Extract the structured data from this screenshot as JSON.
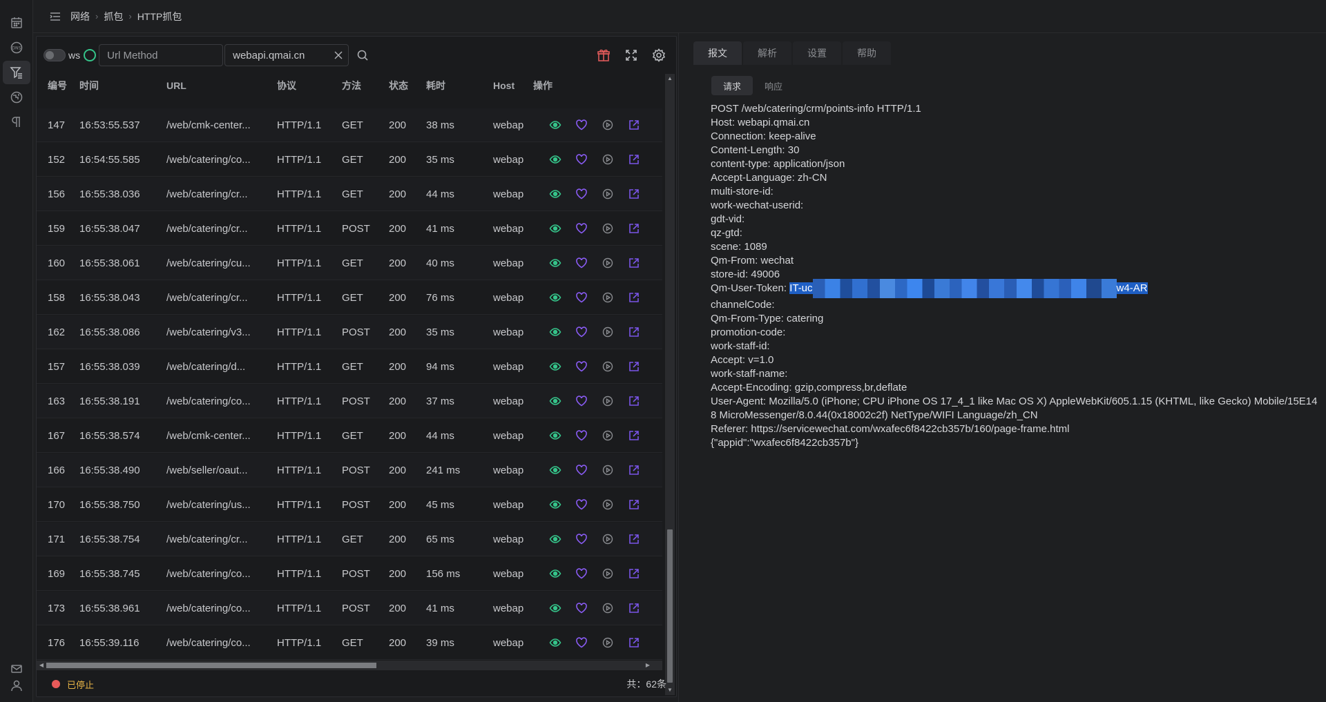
{
  "breadcrumb": [
    "网络",
    "抓包",
    "HTTP抓包"
  ],
  "toolbar": {
    "ws_label": "ws",
    "url_placeholder": "Url Method",
    "host_value": "webapi.qmai.cn"
  },
  "table": {
    "headers": [
      "编号",
      "时间",
      "URL",
      "协议",
      "方法",
      "状态",
      "耗时",
      "Host",
      "操作"
    ],
    "rows": [
      {
        "id": "147",
        "time": "16:53:55.537",
        "url": "/web/cmk-center...",
        "proto": "HTTP/1.1",
        "method": "GET",
        "status": "200",
        "cost": "38 ms",
        "host": "webap"
      },
      {
        "id": "152",
        "time": "16:54:55.585",
        "url": "/web/catering/co...",
        "proto": "HTTP/1.1",
        "method": "GET",
        "status": "200",
        "cost": "35 ms",
        "host": "webap"
      },
      {
        "id": "156",
        "time": "16:55:38.036",
        "url": "/web/catering/cr...",
        "proto": "HTTP/1.1",
        "method": "GET",
        "status": "200",
        "cost": "44 ms",
        "host": "webap"
      },
      {
        "id": "159",
        "time": "16:55:38.047",
        "url": "/web/catering/cr...",
        "proto": "HTTP/1.1",
        "method": "POST",
        "status": "200",
        "cost": "41 ms",
        "host": "webap"
      },
      {
        "id": "160",
        "time": "16:55:38.061",
        "url": "/web/catering/cu...",
        "proto": "HTTP/1.1",
        "method": "GET",
        "status": "200",
        "cost": "40 ms",
        "host": "webap"
      },
      {
        "id": "158",
        "time": "16:55:38.043",
        "url": "/web/catering/cr...",
        "proto": "HTTP/1.1",
        "method": "GET",
        "status": "200",
        "cost": "76 ms",
        "host": "webap"
      },
      {
        "id": "162",
        "time": "16:55:38.086",
        "url": "/web/catering/v3...",
        "proto": "HTTP/1.1",
        "method": "POST",
        "status": "200",
        "cost": "35 ms",
        "host": "webap"
      },
      {
        "id": "157",
        "time": "16:55:38.039",
        "url": "/web/catering/d...",
        "proto": "HTTP/1.1",
        "method": "GET",
        "status": "200",
        "cost": "94 ms",
        "host": "webap"
      },
      {
        "id": "163",
        "time": "16:55:38.191",
        "url": "/web/catering/co...",
        "proto": "HTTP/1.1",
        "method": "POST",
        "status": "200",
        "cost": "37 ms",
        "host": "webap"
      },
      {
        "id": "167",
        "time": "16:55:38.574",
        "url": "/web/cmk-center...",
        "proto": "HTTP/1.1",
        "method": "GET",
        "status": "200",
        "cost": "44 ms",
        "host": "webap"
      },
      {
        "id": "166",
        "time": "16:55:38.490",
        "url": "/web/seller/oaut...",
        "proto": "HTTP/1.1",
        "method": "POST",
        "status": "200",
        "cost": "241 ms",
        "host": "webap"
      },
      {
        "id": "170",
        "time": "16:55:38.750",
        "url": "/web/catering/us...",
        "proto": "HTTP/1.1",
        "method": "POST",
        "status": "200",
        "cost": "45 ms",
        "host": "webap"
      },
      {
        "id": "171",
        "time": "16:55:38.754",
        "url": "/web/catering/cr...",
        "proto": "HTTP/1.1",
        "method": "GET",
        "status": "200",
        "cost": "65 ms",
        "host": "webap"
      },
      {
        "id": "169",
        "time": "16:55:38.745",
        "url": "/web/catering/co...",
        "proto": "HTTP/1.1",
        "method": "POST",
        "status": "200",
        "cost": "156 ms",
        "host": "webap"
      },
      {
        "id": "173",
        "time": "16:55:38.961",
        "url": "/web/catering/co...",
        "proto": "HTTP/1.1",
        "method": "POST",
        "status": "200",
        "cost": "41 ms",
        "host": "webap"
      },
      {
        "id": "176",
        "time": "16:55:39.116",
        "url": "/web/catering/co...",
        "proto": "HTTP/1.1",
        "method": "GET",
        "status": "200",
        "cost": "39 ms",
        "host": "webap"
      }
    ]
  },
  "status": {
    "state": "已停止",
    "total": "共：62条"
  },
  "detail": {
    "tabs": [
      "报文",
      "解析",
      "设置",
      "帮助"
    ],
    "sub_tabs": [
      "请求",
      "响应"
    ],
    "lines": [
      "POST /web/catering/crm/points-info HTTP/1.1",
      "Host: webapi.qmai.cn",
      "Connection: keep-alive",
      "Content-Length: 30",
      "content-type: application/json",
      "Accept-Language: zh-CN",
      "multi-store-id:",
      "work-wechat-userid:",
      "gdt-vid:",
      "qz-gtd:",
      "scene: 1089",
      "Qm-From: wechat",
      "store-id: 49006"
    ],
    "token_key": "Qm-User-Token: ",
    "token_start": "IT-uc",
    "token_end": "w4-AR",
    "lines_after": [
      "channelCode:",
      "Qm-From-Type: catering",
      "promotion-code:",
      "work-staff-id:",
      "Accept: v=1.0",
      "work-staff-name:",
      "Accept-Encoding: gzip,compress,br,deflate",
      "User-Agent: Mozilla/5.0 (iPhone; CPU iPhone OS 17_4_1 like Mac OS X) AppleWebKit/605.1.15 (KHTML, like Gecko) Mobile/15E148 MicroMessenger/8.0.44(0x18002c2f) NetType/WIFI Language/zh_CN",
      "Referer: https://servicewechat.com/wxafec6f8422cb357b/160/page-frame.html",
      "{\"appid\":\"wxafec6f8422cb357b\"}"
    ]
  },
  "colors": {
    "eye": "#35c48a",
    "heart": "#8a5cf5",
    "share": "#7a55e8",
    "stop_dot": "#e85a5a",
    "stop_text": "#e8b446",
    "selection": "#1f5fc4"
  },
  "icons": [
    "calendar-icon",
    "dns-icon",
    "filter-icon",
    "network-icon",
    "pilcrow-icon",
    "mail-icon",
    "user-icon",
    "menu-icon",
    "search-icon",
    "clear-icon",
    "gift-icon",
    "fullscreen-icon",
    "gear-icon",
    "eye-icon",
    "heart-icon",
    "play-icon",
    "share-icon"
  ]
}
